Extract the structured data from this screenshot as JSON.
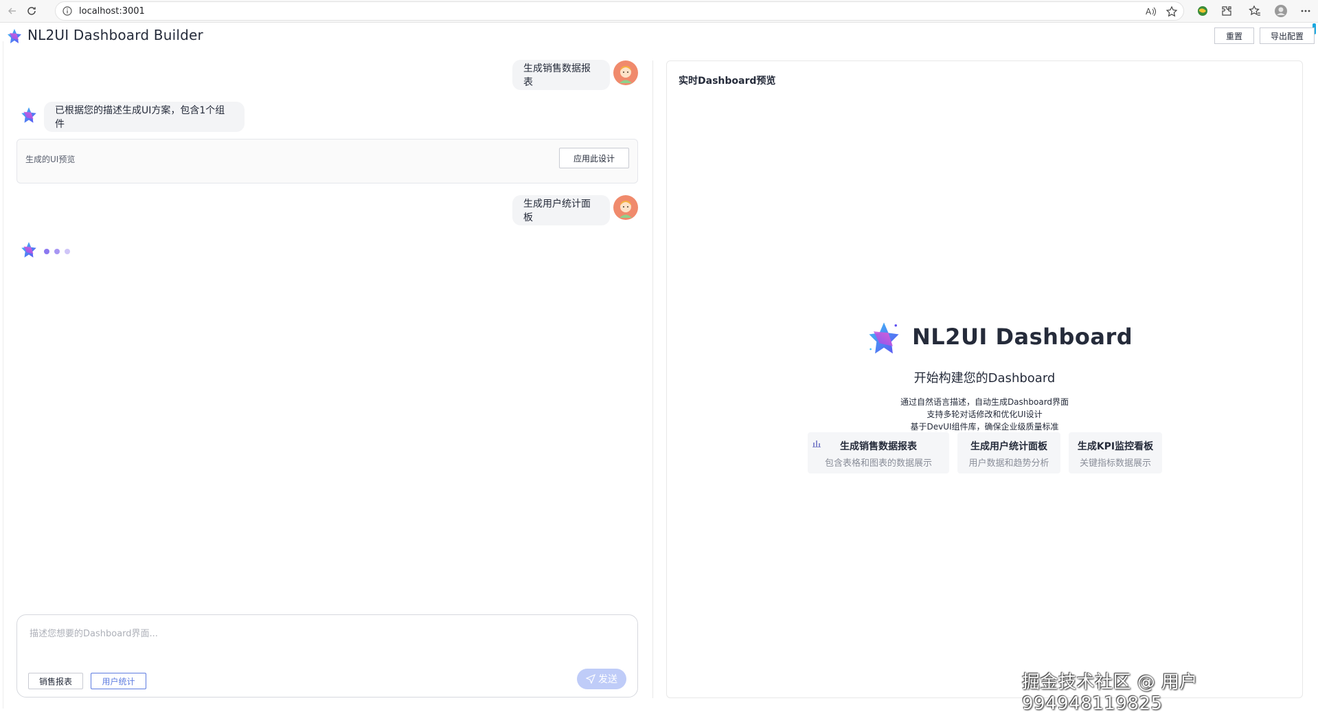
{
  "browser": {
    "url": "localhost:3001"
  },
  "header": {
    "title": "NL2UI Dashboard Builder",
    "reset_label": "重置",
    "export_label": "导出配置"
  },
  "chat": {
    "messages": [
      {
        "role": "user",
        "text": "生成销售数据报表"
      },
      {
        "role": "assistant",
        "text": "已根据您的描述生成UI方案，包含1个组件"
      },
      {
        "role": "user",
        "text": "生成用户统计面板"
      }
    ],
    "preview_card": {
      "label": "生成的UI预览",
      "apply_label": "应用此设计"
    },
    "input": {
      "placeholder": "描述您想要的Dashboard界面...",
      "value": ""
    },
    "chips": [
      "销售报表",
      "用户统计"
    ],
    "send_label": "发送"
  },
  "preview": {
    "title": "实时Dashboard预览",
    "hero_title": "NL2UI Dashboard",
    "hero_subtitle": "开始构建您的Dashboard",
    "hero_lines": [
      "通过自然语言描述，自动生成Dashboard界面",
      "支持多轮对话修改和优化UI设计",
      "基于DevUI组件库，确保企业级质量标准"
    ],
    "quick_cards": [
      {
        "title": "生成销售数据报表",
        "desc": "包含表格和图表的数据展示",
        "icon": "bar-chart-icon"
      },
      {
        "title": "生成用户统计面板",
        "desc": "用户数据和趋势分析"
      },
      {
        "title": "生成KPI监控看板",
        "desc": "关键指标数据展示"
      }
    ]
  },
  "watermark": "掘金技术社区 @ 用户994948119825",
  "colors": {
    "primary": "#5e7ce0",
    "send_disabled": "#bfccf8",
    "avatar": "#f08a6c",
    "bubble": "#f3f4f6"
  }
}
